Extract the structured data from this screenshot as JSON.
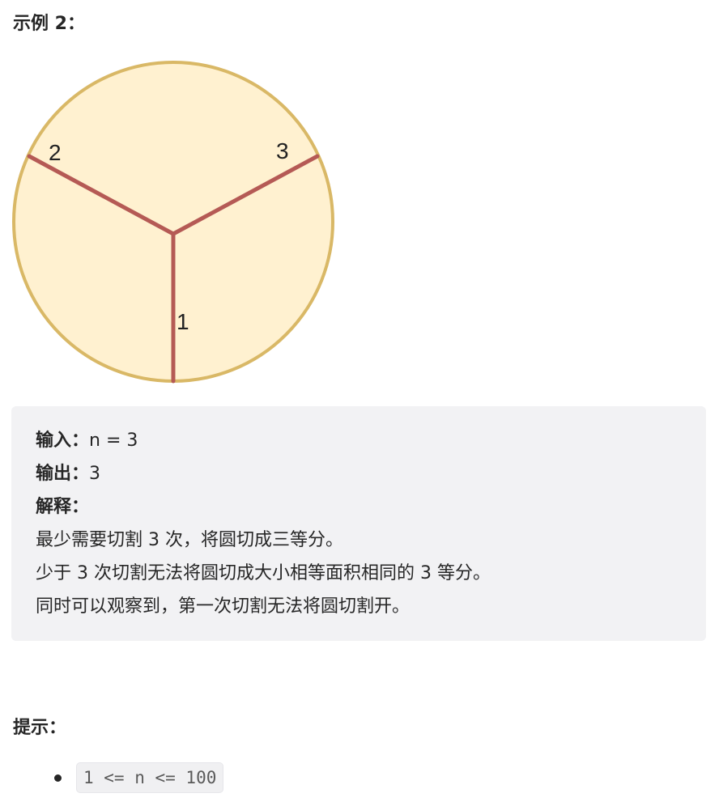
{
  "example": {
    "title": "示例 2："
  },
  "figure": {
    "colors": {
      "fill": "#fff1d0",
      "rim": "#d9b866",
      "cut": "#b55a55",
      "label": "#222222"
    },
    "labels": [
      "1",
      "2",
      "3"
    ]
  },
  "codebox": {
    "input_label": "输入：",
    "input_value": "n = 3",
    "output_label": "输出：",
    "output_value": "3",
    "explain_label": "解释：",
    "explain_lines": [
      "最少需要切割 3 次，将圆切成三等分。",
      "少于 3 次切割无法将圆切成大小相等面积相同的 3 等分。",
      "同时可以观察到，第一次切割无法将圆切割开。"
    ]
  },
  "hints": {
    "title": "提示：",
    "items": [
      "1 <= n <= 100"
    ]
  }
}
